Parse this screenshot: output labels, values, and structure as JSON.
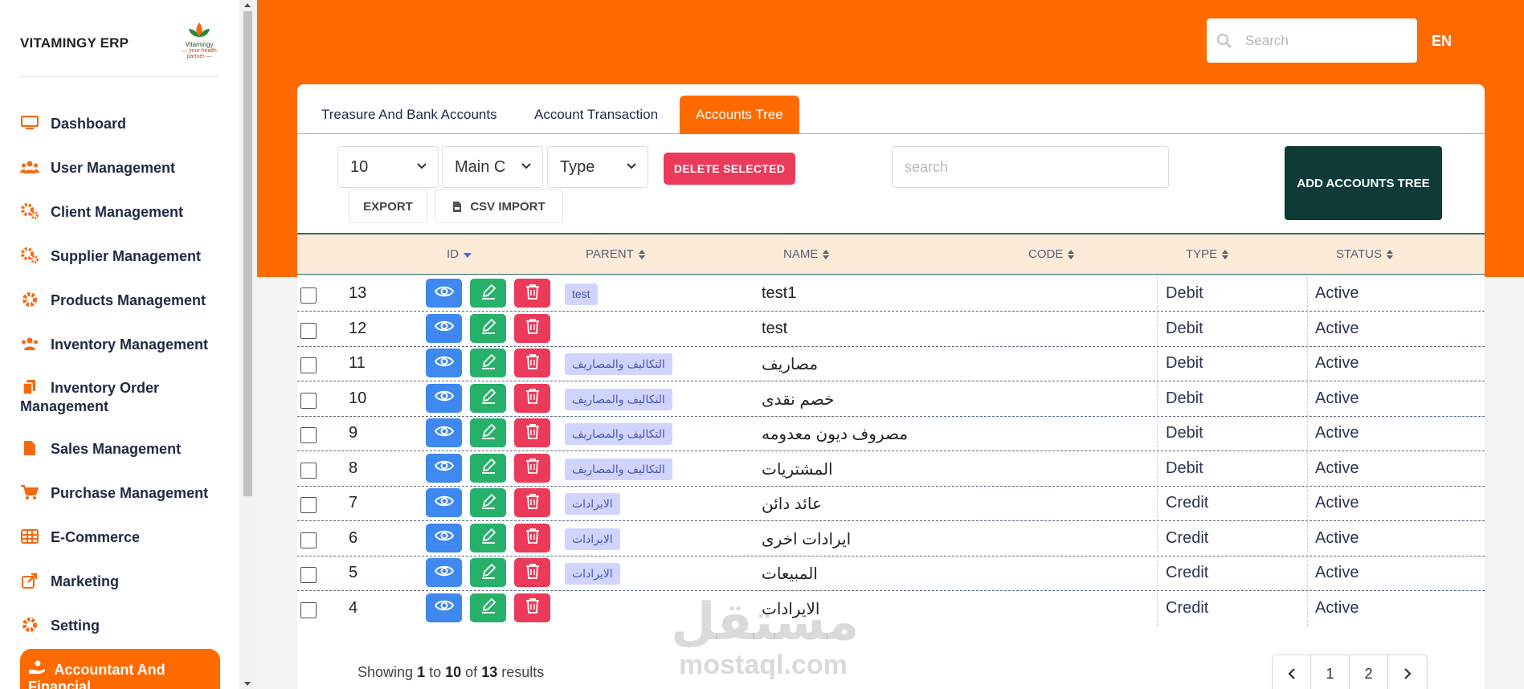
{
  "brand": {
    "name": "VITAMINGY ERP",
    "logo_text": "Vitamingy",
    "logo_tagline": "— your health partner —"
  },
  "sidebar": {
    "items": [
      {
        "label": "Dashboard",
        "icon": "monitor-icon"
      },
      {
        "label": "User Management",
        "icon": "users-icon"
      },
      {
        "label": "Client Management",
        "icon": "gears-icon"
      },
      {
        "label": "Supplier Management",
        "icon": "gears-icon"
      },
      {
        "label": "Products Management",
        "icon": "gear-icon"
      },
      {
        "label": "Inventory Management",
        "icon": "users-icon"
      },
      {
        "label": "Inventory Order Management",
        "icon": "file-copy-icon"
      },
      {
        "label": "Sales Management",
        "icon": "file-icon"
      },
      {
        "label": "Purchase Management",
        "icon": "cart-icon"
      },
      {
        "label": "E-Commerce",
        "icon": "grid-icon"
      },
      {
        "label": "Marketing",
        "icon": "share-icon"
      },
      {
        "label": "Setting",
        "icon": "gear-icon"
      }
    ],
    "active": {
      "label": "Accountant And Financial",
      "icon": "hand-coin-icon"
    }
  },
  "header": {
    "search_placeholder": "Search",
    "language": "EN"
  },
  "tabs": [
    {
      "label": "Treasure And Bank Accounts",
      "active": false
    },
    {
      "label": "Account Transaction",
      "active": false
    },
    {
      "label": "Accounts Tree",
      "active": true
    }
  ],
  "toolbar": {
    "page_size": "10",
    "main_filter": "Main C",
    "type_filter": "Type",
    "delete_label": "DELETE SELECTED",
    "search_placeholder": "search",
    "add_label": "ADD ACCOUNTS TREE",
    "export_label": "EXPORT",
    "csv_label": "CSV IMPORT"
  },
  "table": {
    "columns": [
      "ID",
      "PARENT",
      "NAME",
      "CODE",
      "TYPE",
      "STATUS"
    ],
    "rows": [
      {
        "id": "13",
        "parent": "test",
        "name": "test1",
        "code": "",
        "type": "Debit",
        "status": "Active"
      },
      {
        "id": "12",
        "parent": "",
        "name": "test",
        "code": "",
        "type": "Debit",
        "status": "Active"
      },
      {
        "id": "11",
        "parent": "التكاليف والمصاريف",
        "name": "مصاريف",
        "code": "",
        "type": "Debit",
        "status": "Active"
      },
      {
        "id": "10",
        "parent": "التكاليف والمصاريف",
        "name": "خصم نقدى",
        "code": "",
        "type": "Debit",
        "status": "Active"
      },
      {
        "id": "9",
        "parent": "التكاليف والمصاريف",
        "name": "مصروف ديون معدومه",
        "code": "",
        "type": "Debit",
        "status": "Active"
      },
      {
        "id": "8",
        "parent": "التكاليف والمصاريف",
        "name": "المشتريات",
        "code": "",
        "type": "Debit",
        "status": "Active"
      },
      {
        "id": "7",
        "parent": "الايرادات",
        "name": "عائد دائن",
        "code": "",
        "type": "Credit",
        "status": "Active"
      },
      {
        "id": "6",
        "parent": "الايرادات",
        "name": "ايرادات اخرى",
        "code": "",
        "type": "Credit",
        "status": "Active"
      },
      {
        "id": "5",
        "parent": "الايرادات",
        "name": "المبيعات",
        "code": "",
        "type": "Credit",
        "status": "Active"
      },
      {
        "id": "4",
        "parent": "",
        "name": "الايرادات",
        "code": "",
        "type": "Credit",
        "status": "Active"
      }
    ]
  },
  "footer": {
    "showing": "Showing",
    "from": "1",
    "to_word": "to",
    "to": "10",
    "of_word": "of",
    "total": "13",
    "results": "results",
    "pages": [
      "1",
      "2"
    ]
  },
  "watermark": {
    "line1": "مستقل",
    "line2": "mostaql.com"
  },
  "colors": {
    "accent": "#ff6a00",
    "dark_green": "#0e3b35",
    "danger": "#ec3a5a",
    "view": "#3e88ef",
    "edit": "#27b06a"
  }
}
